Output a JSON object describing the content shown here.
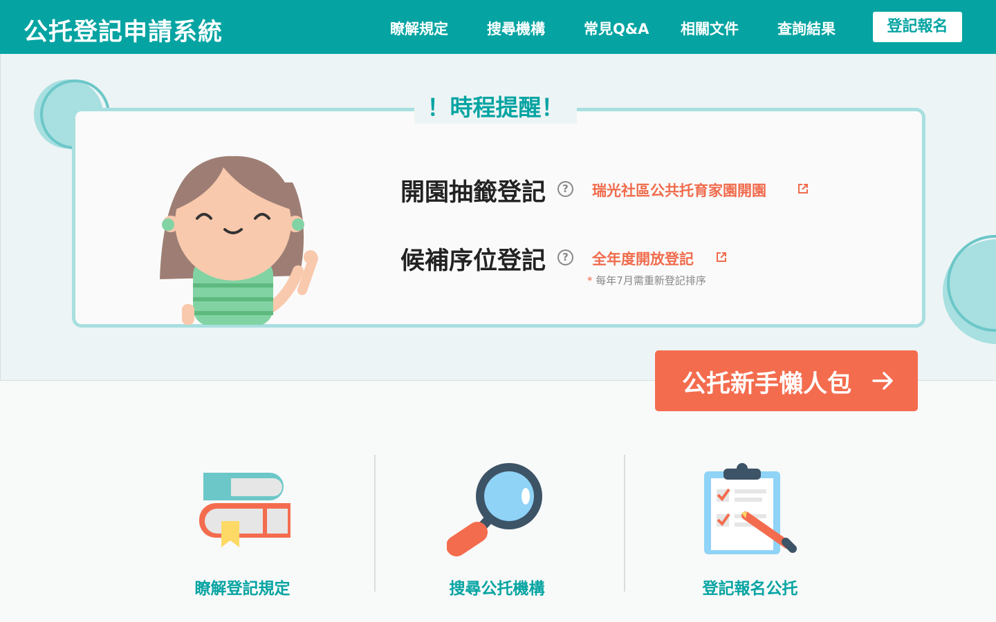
{
  "header": {
    "title": "公托登記申請系統",
    "nav": [
      "瞭解規定",
      "搜尋機構",
      "常見Q&A",
      "相關文件",
      "查詢結果"
    ],
    "cta": "登記報名"
  },
  "reminder": {
    "title": "！時程提醒！",
    "rows": [
      {
        "label": "開園抽籤登記",
        "help": "?",
        "link": "瑞光社區公共托育家園開園"
      },
      {
        "label": "候補序位登記",
        "help": "?",
        "link": "全年度開放登記",
        "note_star": "*",
        "note": "每年7月需重新登記排序"
      }
    ]
  },
  "guide_button": {
    "label": "公托新手懶人包"
  },
  "cards": [
    {
      "label": "瞭解登記規定",
      "icon": "books-icon"
    },
    {
      "label": "搜尋公托機構",
      "icon": "magnifier-icon"
    },
    {
      "label": "登記報名公托",
      "icon": "clipboard-icon"
    }
  ],
  "colors": {
    "primary": "#05a4a2",
    "accent": "#f46c4e",
    "link": "#f06b4c",
    "light_teal": "#a8dfe0"
  }
}
